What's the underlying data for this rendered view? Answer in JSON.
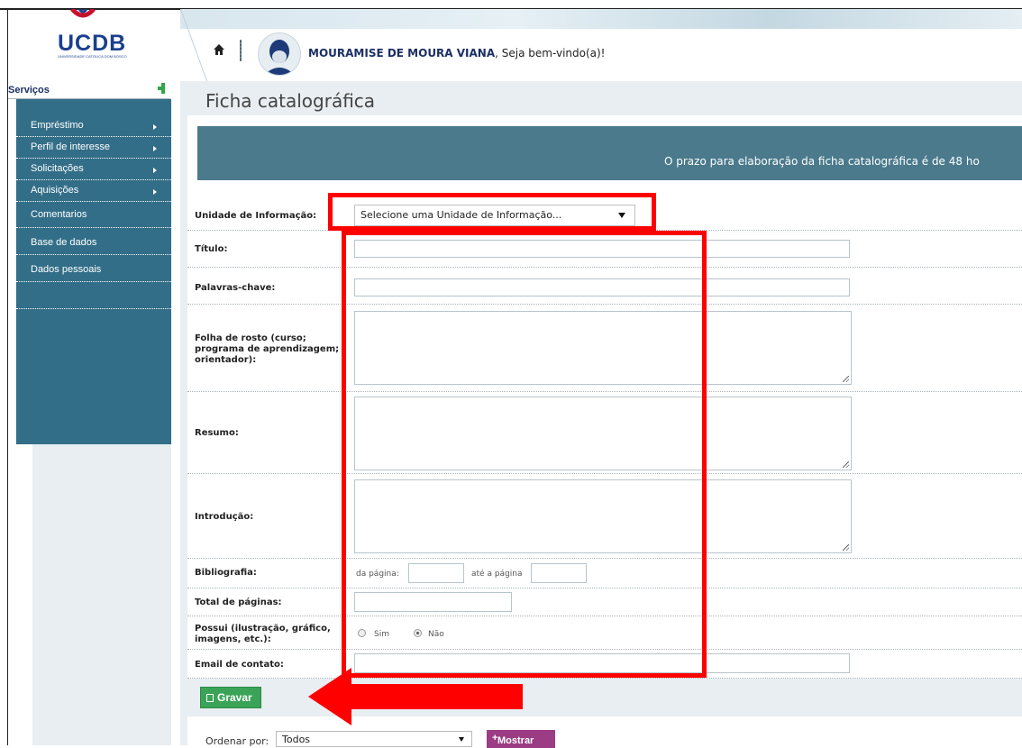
{
  "logo": {
    "text": "UCDB",
    "subtitle": "UNIVERSIDADE CATÓLICA DOM BOSCO"
  },
  "header": {
    "user_name": "MOURAMISE DE MOURA VIANA",
    "greeting": ", Seja bem-vindo(a)!"
  },
  "sidebar": {
    "title": "Serviços",
    "items": [
      {
        "label": "Empréstimo",
        "has_submenu": true
      },
      {
        "label": "Perfil de interesse",
        "has_submenu": true
      },
      {
        "label": "Solicitações",
        "has_submenu": true
      },
      {
        "label": "Aquisições",
        "has_submenu": true
      },
      {
        "label": "Comentarios",
        "has_submenu": false
      },
      {
        "label": "Base de dados",
        "has_submenu": false
      },
      {
        "label": "Dados pessoais",
        "has_submenu": false
      }
    ]
  },
  "page": {
    "title": "Ficha catalográfica",
    "notice": "O prazo para elaboração da ficha catalográfica é de 48 ho"
  },
  "form": {
    "unidade_label": "Unidade de Informação:",
    "unidade_value": "Selecione uma Unidade de Informação...",
    "titulo_label": "Título:",
    "palavras_label": "Palavras-chave:",
    "folha_label_1": "Folha de rosto (curso;",
    "folha_label_2": "programa de aprendizagem;",
    "folha_label_3": "orientador):",
    "resumo_label": "Resumo:",
    "introducao_label": "Introdução:",
    "bibliografia_label": "Bibliografia:",
    "da_pagina": "da página:",
    "ate_pagina": "até a página",
    "total_label": "Total de páginas:",
    "possui_label_1": "Possui (ilustração, gráfico,",
    "possui_label_2": "imagens, etc.):",
    "sim": "Sim",
    "nao": "Não",
    "possui_selected": "Não",
    "email_label": "Email de contato:"
  },
  "actions": {
    "gravar": "Gravar"
  },
  "ordering": {
    "label": "Ordenar por:",
    "value": "Todos",
    "mostrar": "Mostrar"
  },
  "colors": {
    "sidebar": "#336e88",
    "notice": "#4a7a8c",
    "gravar": "#3aa357",
    "mostrar": "#9b3c84",
    "annotation": "#ff0000"
  }
}
